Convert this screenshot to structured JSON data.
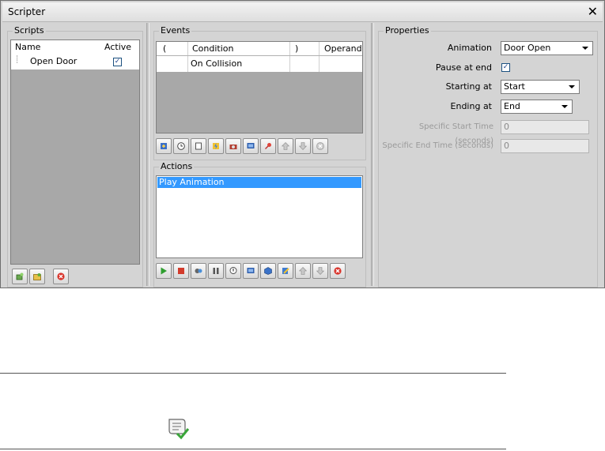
{
  "window": {
    "title": "Scripter",
    "close_glyph": "✕"
  },
  "scripts": {
    "label": "Scripts",
    "columns": [
      "Name",
      "Active"
    ],
    "rows": [
      {
        "name": "Open Door",
        "active": true
      }
    ]
  },
  "events": {
    "label": "Events",
    "columns": [
      "(",
      "Condition",
      ")",
      "Operand"
    ],
    "rows": [
      {
        "open": "",
        "condition": "On Collision",
        "close": "",
        "operand": ""
      }
    ],
    "toolbar_icons": [
      "add-event-icon",
      "clock-icon",
      "page-icon",
      "lightning-icon",
      "camera-icon",
      "monitor-icon",
      "key-icon",
      "move-up-icon",
      "move-down-icon",
      "delete-icon"
    ]
  },
  "actions": {
    "label": "Actions",
    "items": [
      "Play Animation"
    ],
    "toolbar_icons": [
      "play-icon",
      "stop-icon",
      "animate-icon",
      "pause-icon",
      "alert-icon",
      "monitor-icon",
      "cube-icon",
      "pencil-icon",
      "move-up-icon",
      "move-down-icon",
      "delete-icon"
    ]
  },
  "properties": {
    "label": "Properties",
    "animation": {
      "label": "Animation",
      "value": "Door Open"
    },
    "pause_at_end": {
      "label": "Pause at end",
      "checked": true
    },
    "starting_at": {
      "label": "Starting at",
      "value": "Start"
    },
    "ending_at": {
      "label": "Ending at",
      "value": "End"
    },
    "specific_start": {
      "label": "Specific Start Time (seconds)",
      "value": "0"
    },
    "specific_end": {
      "label": "Specific End Time (seconds)",
      "value": "0"
    }
  },
  "scripts_toolbar_icons": [
    "new-script-icon",
    "open-folder-icon",
    "delete-icon"
  ],
  "footer_icon": "script-check-icon",
  "colors": {
    "selection": "#3399ff",
    "grid_bg": "#a8a8a8",
    "panel": "#d4d4d4"
  }
}
